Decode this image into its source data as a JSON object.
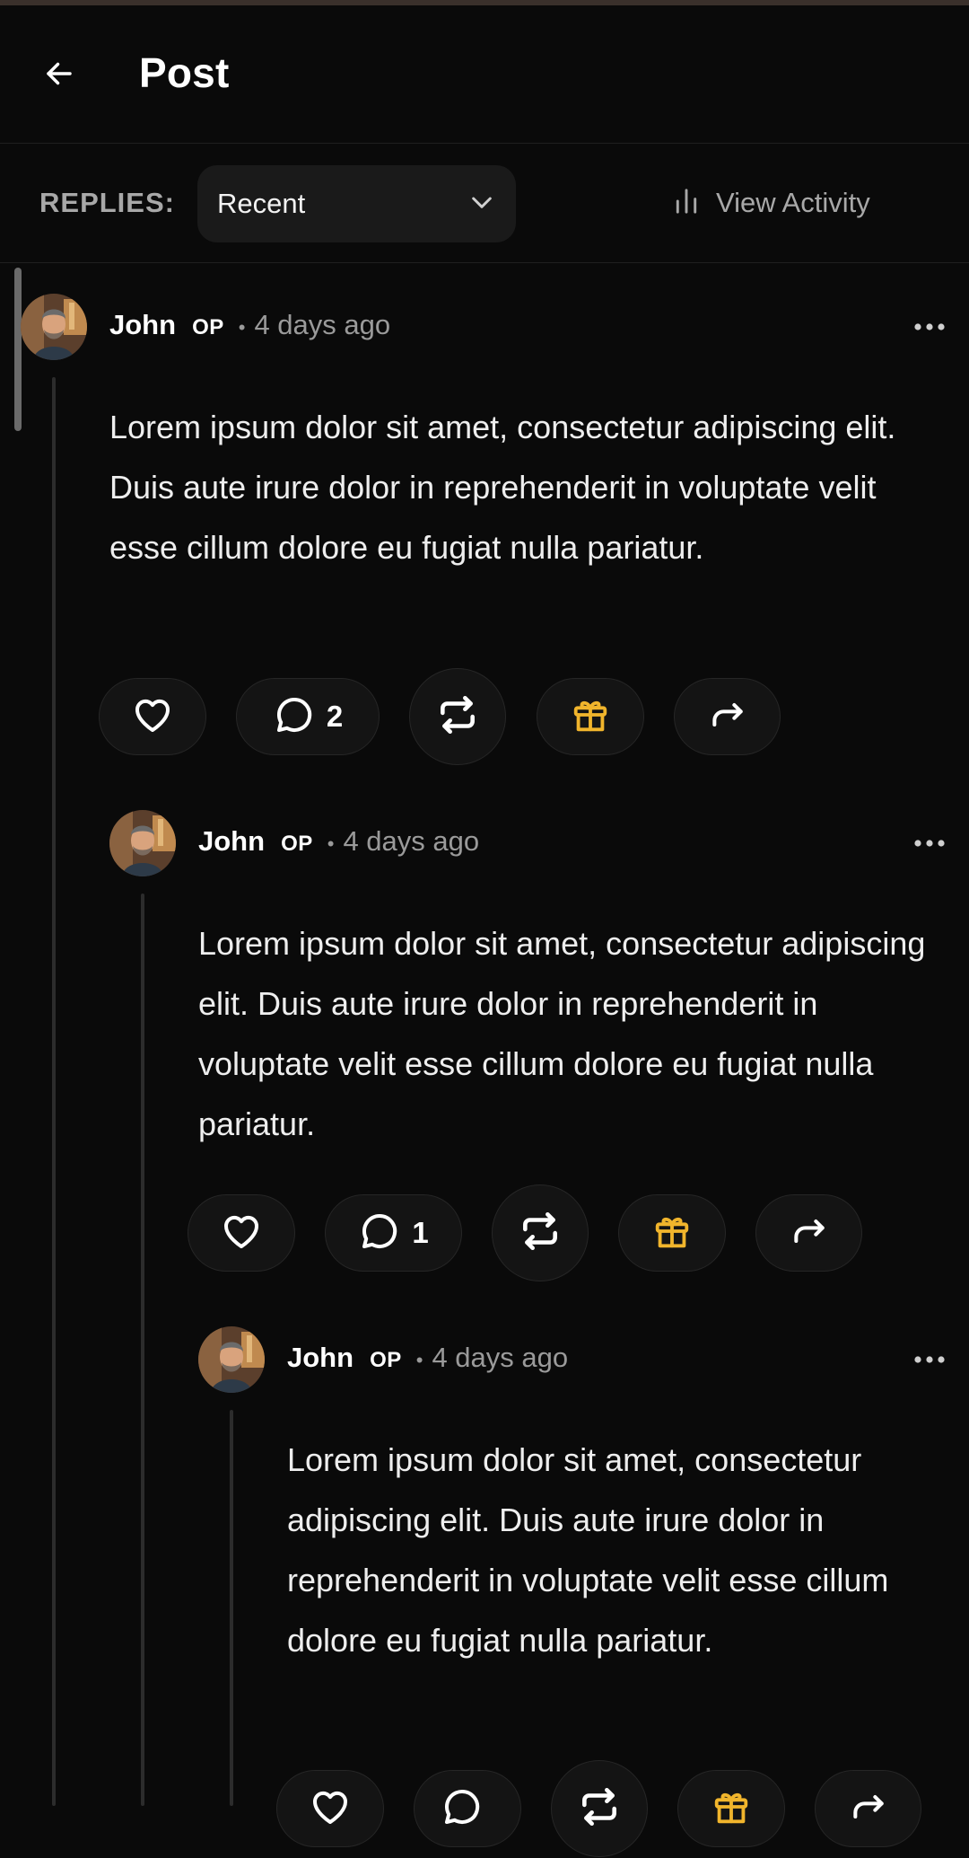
{
  "header": {
    "title": "Post"
  },
  "toolbar": {
    "replies_label": "REPLIES:",
    "sort_value": "Recent",
    "view_activity_label": "View Activity"
  },
  "colors": {
    "background": "#0a0a0a",
    "gift_accent": "#f1b52c",
    "muted_text": "#9a9a9a"
  },
  "comments": [
    {
      "author": "John",
      "badge": "OP",
      "separator": "•",
      "time": "4 days ago",
      "body": "Lorem ipsum dolor sit amet, consectetur adipiscing elit. Duis aute irure dolor in reprehenderit in voluptate velit esse cillum dolore eu fugiat nulla pariatur.",
      "reply_count": "2"
    },
    {
      "author": "John",
      "badge": "OP",
      "separator": "•",
      "time": "4 days ago",
      "body": "Lorem ipsum dolor sit amet, consectetur adipiscing elit. Duis aute irure dolor in reprehenderit in voluptate velit esse cillum dolore eu fugiat nulla pariatur.",
      "reply_count": "1"
    },
    {
      "author": "John",
      "badge": "OP",
      "separator": "•",
      "time": "4 days ago",
      "body": "Lorem ipsum dolor sit amet, consectetur adipiscing elit. Duis aute irure dolor in reprehenderit in voluptate velit esse cillum dolore eu fugiat nulla pariatur.",
      "reply_count": ""
    }
  ],
  "icons": [
    "arrow-left-icon",
    "chevron-down-icon",
    "bar-chart-icon",
    "heart-icon",
    "chat-bubble-icon",
    "repost-icon",
    "gift-icon",
    "share-icon",
    "more-horizontal-icon"
  ]
}
